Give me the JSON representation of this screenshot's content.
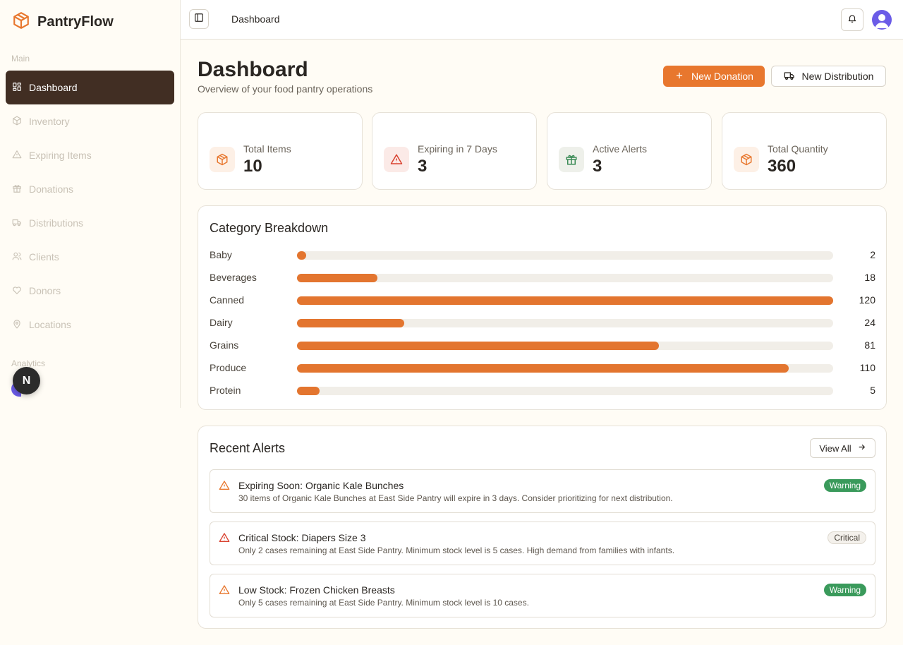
{
  "brand": {
    "name": "PantryFlow"
  },
  "sidebar": {
    "section_main": "Main",
    "section_analytics": "Analytics",
    "items": [
      {
        "label": "Dashboard",
        "icon": "dashboard-icon",
        "active": true
      },
      {
        "label": "Inventory",
        "icon": "package-icon"
      },
      {
        "label": "Expiring Items",
        "icon": "alert-triangle-icon"
      },
      {
        "label": "Donations",
        "icon": "gift-icon"
      },
      {
        "label": "Distributions",
        "icon": "truck-icon"
      },
      {
        "label": "Clients",
        "icon": "users-icon"
      },
      {
        "label": "Donors",
        "icon": "heart-icon"
      },
      {
        "label": "Locations",
        "icon": "map-pin-icon"
      }
    ],
    "fab_label": "N"
  },
  "topbar": {
    "title": "Dashboard"
  },
  "header": {
    "title": "Dashboard",
    "subtitle": "Overview of your food pantry operations",
    "new_donation": "New Donation",
    "new_distribution": "New Distribution"
  },
  "stats": [
    {
      "label": "Total Items",
      "value": "10",
      "icon": "package-icon",
      "color": "#e8772e"
    },
    {
      "label": "Expiring in 7 Days",
      "value": "3",
      "icon": "alert-triangle-icon",
      "color": "#d9412f"
    },
    {
      "label": "Active Alerts",
      "value": "3",
      "icon": "gift-icon",
      "color": "#3a8a55"
    },
    {
      "label": "Total Quantity",
      "value": "360",
      "icon": "package-icon",
      "color": "#e8772e"
    }
  ],
  "category_breakdown": {
    "title": "Category Breakdown",
    "max": 120,
    "rows": [
      {
        "name": "Baby",
        "value": 2
      },
      {
        "name": "Beverages",
        "value": 18
      },
      {
        "name": "Canned",
        "value": 120
      },
      {
        "name": "Dairy",
        "value": 24
      },
      {
        "name": "Grains",
        "value": 81
      },
      {
        "name": "Produce",
        "value": 110
      },
      {
        "name": "Protein",
        "value": 5
      }
    ]
  },
  "recent_alerts": {
    "title": "Recent Alerts",
    "view_all": "View All",
    "items": [
      {
        "title": "Expiring Soon: Organic Kale Bunches",
        "message": "30 items of Organic Kale Bunches at East Side Pantry will expire in 3 days. Consider prioritizing for next distribution.",
        "badge": "Warning",
        "level": "warning"
      },
      {
        "title": "Critical Stock: Diapers Size 3",
        "message": "Only 2 cases remaining at East Side Pantry. Minimum stock level is 5 cases. High demand from families with infants.",
        "badge": "Critical",
        "level": "critical"
      },
      {
        "title": "Low Stock: Frozen Chicken Breasts",
        "message": "Only 5 cases remaining at East Side Pantry. Minimum stock level is 10 cases.",
        "badge": "Warning",
        "level": "warning"
      }
    ]
  },
  "colors": {
    "accent": "#e8772e",
    "sidebar_active": "#412e23",
    "success": "#3a9a5b",
    "danger": "#d9412f"
  }
}
